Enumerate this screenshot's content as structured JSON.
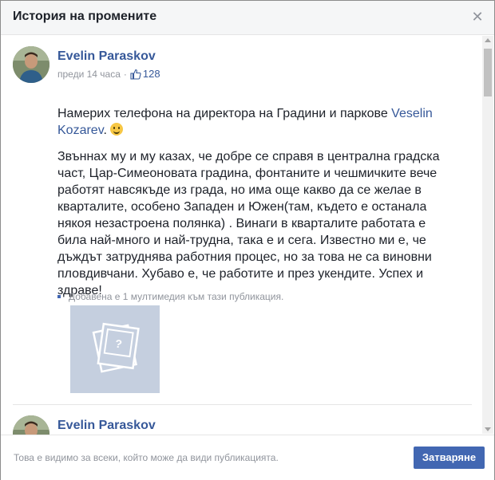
{
  "dialog": {
    "title": "История на промените",
    "close_icon": "close-icon"
  },
  "posts": [
    {
      "author": "Evelin Paraskov",
      "time": "преди 14 часа",
      "like_count": "128",
      "paragraph1_before_link": "Намерих телефона на директора на Градини и паркове ",
      "paragraph1_link": "Veselin Kozarev",
      "paragraph1_after_link": ". ",
      "paragraph2": "Звъннах му и му казах, че добре се справя в централна градска част, Цар-Симеоновата градина, фонтаните и чешмичките вече работят навсякъде из града, но има още какво да се желае в кварталите, особено Западен и Южен(там, където е останала някоя незастроена полянка) . Винаги в кварталите работата е била най-много и най-трудна, така е и сега. Известно ми е, че дъждът затруднява работния процес, но за това не са виновни пловдивчани. Хубаво е, че работите и през укендите. Успех и здраве!",
      "media_note": "Добавена е 1 мултимедия към тази публикация."
    },
    {
      "author": "Evelin Paraskov"
    }
  ],
  "footer": {
    "visibility_note": "Това е видимо за всеки, който може да види публикацията.",
    "close_label": "Затваряне"
  },
  "colors": {
    "link": "#365899",
    "button": "#4267b2",
    "meta": "#90949c"
  }
}
